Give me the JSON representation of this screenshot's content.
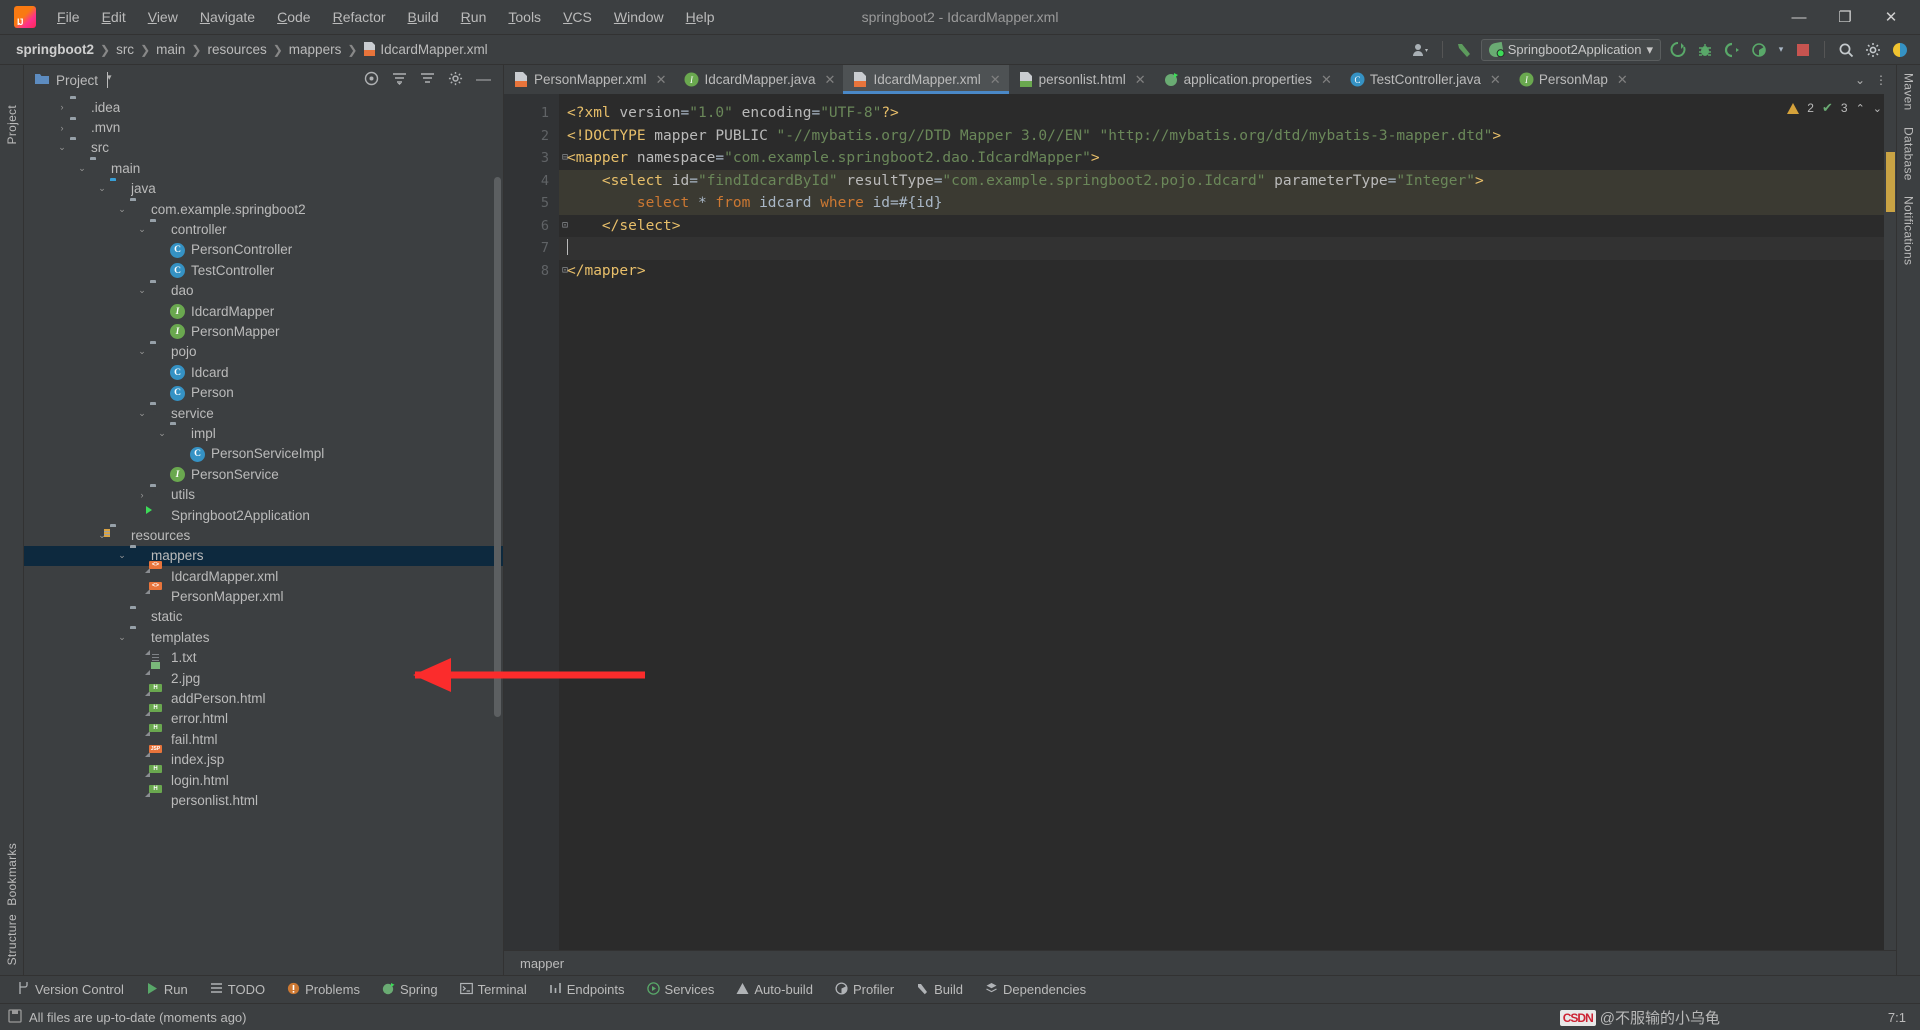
{
  "window": {
    "title": "springboot2 - IdcardMapper.xml",
    "minimize": "—",
    "maximize": "❐",
    "close": "✕"
  },
  "menu": [
    {
      "label": "File"
    },
    {
      "label": "Edit"
    },
    {
      "label": "View"
    },
    {
      "label": "Navigate"
    },
    {
      "label": "Code"
    },
    {
      "label": "Refactor"
    },
    {
      "label": "Build"
    },
    {
      "label": "Run"
    },
    {
      "label": "Tools"
    },
    {
      "label": "VCS"
    },
    {
      "label": "Window"
    },
    {
      "label": "Help"
    }
  ],
  "breadcrumb": {
    "segments": [
      "springboot2",
      "src",
      "main",
      "resources",
      "mappers",
      "IdcardMapper.xml"
    ],
    "separator": "❯"
  },
  "toolbar": {
    "run_config": "Springboot2Application",
    "dropdown_caret": "▾",
    "icons": [
      {
        "name": "account-icon",
        "glyph": "♟"
      },
      {
        "name": "build-hammer-icon",
        "glyph": "⚒"
      },
      {
        "name": "run-icon",
        "glyph": "➤"
      },
      {
        "name": "debug-icon",
        "glyph": "⚙"
      },
      {
        "name": "run-coverage-icon",
        "glyph": "◔"
      },
      {
        "name": "profiler-icon",
        "glyph": "◑"
      },
      {
        "name": "stop-icon",
        "glyph": "■"
      },
      {
        "name": "search-everywhere-icon",
        "glyph": "⌕"
      },
      {
        "name": "settings-gear-icon",
        "glyph": "⚙"
      },
      {
        "name": "ide-feature-icon",
        "glyph": "◕"
      }
    ]
  },
  "project_panel": {
    "title": "Project",
    "caret": "▾",
    "tool_icons": [
      {
        "name": "select-opened-file-icon",
        "glyph": "◎"
      },
      {
        "name": "expand-all-icon",
        "glyph": "≡"
      },
      {
        "name": "collapse-all-icon",
        "glyph": "≡"
      },
      {
        "name": "settings-gear-icon",
        "glyph": "⚙"
      },
      {
        "name": "hide-panel-icon",
        "glyph": "—"
      }
    ],
    "tree": [
      {
        "label": ".idea",
        "indent": 1,
        "arrow": "›",
        "icon": "folder",
        "selected": false
      },
      {
        "label": ".mvn",
        "indent": 1,
        "arrow": "›",
        "icon": "folder",
        "selected": false
      },
      {
        "label": "src",
        "indent": 1,
        "arrow": "⌄",
        "icon": "folder",
        "selected": false
      },
      {
        "label": "main",
        "indent": 2,
        "arrow": "⌄",
        "icon": "folder",
        "selected": false
      },
      {
        "label": "java",
        "indent": 3,
        "arrow": "⌄",
        "icon": "folder-blue",
        "selected": false
      },
      {
        "label": "com.example.springboot2",
        "indent": 4,
        "arrow": "⌄",
        "icon": "package",
        "selected": false
      },
      {
        "label": "controller",
        "indent": 5,
        "arrow": "⌄",
        "icon": "package",
        "selected": false
      },
      {
        "label": "PersonController",
        "indent": 6,
        "arrow": "",
        "icon": "class",
        "selected": false
      },
      {
        "label": "TestController",
        "indent": 6,
        "arrow": "",
        "icon": "class",
        "selected": false
      },
      {
        "label": "dao",
        "indent": 5,
        "arrow": "⌄",
        "icon": "package",
        "selected": false
      },
      {
        "label": "IdcardMapper",
        "indent": 6,
        "arrow": "",
        "icon": "interface",
        "selected": false
      },
      {
        "label": "PersonMapper",
        "indent": 6,
        "arrow": "",
        "icon": "interface",
        "selected": false
      },
      {
        "label": "pojo",
        "indent": 5,
        "arrow": "⌄",
        "icon": "package",
        "selected": false
      },
      {
        "label": "Idcard",
        "indent": 6,
        "arrow": "",
        "icon": "class",
        "selected": false
      },
      {
        "label": "Person",
        "indent": 6,
        "arrow": "",
        "icon": "class",
        "selected": false
      },
      {
        "label": "service",
        "indent": 5,
        "arrow": "⌄",
        "icon": "package",
        "selected": false
      },
      {
        "label": "impl",
        "indent": 6,
        "arrow": "⌄",
        "icon": "package",
        "selected": false
      },
      {
        "label": "PersonServiceImpl",
        "indent": 7,
        "arrow": "",
        "icon": "class",
        "selected": false
      },
      {
        "label": "PersonService",
        "indent": 6,
        "arrow": "",
        "icon": "interface",
        "selected": false
      },
      {
        "label": "utils",
        "indent": 5,
        "arrow": "›",
        "icon": "package",
        "selected": false
      },
      {
        "label": "Springboot2Application",
        "indent": 5,
        "arrow": "",
        "icon": "spring",
        "selected": false
      },
      {
        "label": "resources",
        "indent": 3,
        "arrow": "⌄",
        "icon": "folder-res",
        "selected": false
      },
      {
        "label": "mappers",
        "indent": 4,
        "arrow": "⌄",
        "icon": "folder",
        "selected": true
      },
      {
        "label": "IdcardMapper.xml",
        "indent": 5,
        "arrow": "",
        "icon": "file-xml",
        "selected": false
      },
      {
        "label": "PersonMapper.xml",
        "indent": 5,
        "arrow": "",
        "icon": "file-xml",
        "selected": false
      },
      {
        "label": "static",
        "indent": 4,
        "arrow": "",
        "icon": "folder",
        "selected": false
      },
      {
        "label": "templates",
        "indent": 4,
        "arrow": "⌄",
        "icon": "folder",
        "selected": false
      },
      {
        "label": "1.txt",
        "indent": 5,
        "arrow": "",
        "icon": "file-txt",
        "selected": false
      },
      {
        "label": "2.jpg",
        "indent": 5,
        "arrow": "",
        "icon": "file-img",
        "selected": false
      },
      {
        "label": "addPerson.html",
        "indent": 5,
        "arrow": "",
        "icon": "file-html",
        "selected": false
      },
      {
        "label": "error.html",
        "indent": 5,
        "arrow": "",
        "icon": "file-html",
        "selected": false
      },
      {
        "label": "fail.html",
        "indent": 5,
        "arrow": "",
        "icon": "file-html",
        "selected": false
      },
      {
        "label": "index.jsp",
        "indent": 5,
        "arrow": "",
        "icon": "file-jsp",
        "selected": false
      },
      {
        "label": "login.html",
        "indent": 5,
        "arrow": "",
        "icon": "file-html",
        "selected": false
      },
      {
        "label": "personlist.html",
        "indent": 5,
        "arrow": "",
        "icon": "file-html",
        "selected": false
      }
    ]
  },
  "left_strip": {
    "project": "Project",
    "bookmarks": "Bookmarks",
    "structure": "Structure"
  },
  "right_strip": {
    "maven": "Maven",
    "database": "Database",
    "notifications": "Notifications"
  },
  "editor": {
    "tabs": [
      {
        "label": "PersonMapper.xml",
        "icon": "xml",
        "active": false
      },
      {
        "label": "IdcardMapper.java",
        "icon": "iface",
        "active": false
      },
      {
        "label": "IdcardMapper.xml",
        "icon": "xml",
        "active": true
      },
      {
        "label": "personlist.html",
        "icon": "html",
        "active": false
      },
      {
        "label": "application.properties",
        "icon": "spring",
        "active": false
      },
      {
        "label": "TestController.java",
        "icon": "class",
        "active": false
      },
      {
        "label": "PersonMap",
        "icon": "iface",
        "active": false
      }
    ],
    "tab_close": "✕",
    "tabs_overflow": "⌄",
    "tabs_more": "⋮",
    "line_numbers": [
      "1",
      "2",
      "3",
      "4",
      "5",
      "6",
      "7",
      "8"
    ],
    "inspection": {
      "warnings": "2",
      "weak_warnings": "3",
      "caret_up": "⌃",
      "caret_down": "⌄"
    },
    "breadcrumb_bottom": "mapper",
    "code_lines": [
      {
        "n": 1,
        "tokens": [
          {
            "t": "<?xml",
            "c": "docc"
          },
          {
            "t": " version",
            "c": "attrc"
          },
          {
            "t": "=",
            "c": "plainc"
          },
          {
            "t": "\"1.0\"",
            "c": "strc"
          },
          {
            "t": " encoding",
            "c": "attrc"
          },
          {
            "t": "=",
            "c": "plainc"
          },
          {
            "t": "\"UTF-8\"",
            "c": "strc"
          },
          {
            "t": "?>",
            "c": "docc"
          }
        ]
      },
      {
        "n": 2,
        "tokens": [
          {
            "t": "<!DOCTYPE",
            "c": "docc"
          },
          {
            "t": " mapper PUBLIC ",
            "c": "attrc"
          },
          {
            "t": "\"-//mybatis.org//DTD Mapper 3.0//EN\"",
            "c": "strc"
          },
          {
            "t": " ",
            "c": "plainc"
          },
          {
            "t": "\"http://mybatis.org/dtd/mybatis-3-mapper.dtd\"",
            "c": "strc"
          },
          {
            "t": ">",
            "c": "docc"
          }
        ]
      },
      {
        "n": 3,
        "tokens": [
          {
            "t": "<mapper",
            "c": "tagc"
          },
          {
            "t": " namespace",
            "c": "attrc"
          },
          {
            "t": "=",
            "c": "plainc"
          },
          {
            "t": "\"com.example.springboot2.dao.IdcardMapper\"",
            "c": "strc"
          },
          {
            "t": ">",
            "c": "tagc"
          }
        ]
      },
      {
        "n": 4,
        "tokens": [
          {
            "t": "    <select",
            "c": "tagc"
          },
          {
            "t": " id",
            "c": "attrc"
          },
          {
            "t": "=",
            "c": "plainc"
          },
          {
            "t": "\"findIdcardById\"",
            "c": "strc"
          },
          {
            "t": " resultType",
            "c": "attrc"
          },
          {
            "t": "=",
            "c": "plainc"
          },
          {
            "t": "\"com.example.springboot2.pojo.Idcard\"",
            "c": "strc"
          },
          {
            "t": " parameterType",
            "c": "attrc"
          },
          {
            "t": "=",
            "c": "plainc"
          },
          {
            "t": "\"Integer\"",
            "c": "strc"
          },
          {
            "t": ">",
            "c": "tagc"
          }
        ]
      },
      {
        "n": 5,
        "tokens": [
          {
            "t": "        select ",
            "c": "kwc"
          },
          {
            "t": "* ",
            "c": "plainc"
          },
          {
            "t": "from ",
            "c": "kwc"
          },
          {
            "t": "idcard ",
            "c": "plainc"
          },
          {
            "t": "where ",
            "c": "kwc"
          },
          {
            "t": "id",
            "c": "plainc"
          },
          {
            "t": "=#{id}",
            "c": "plainc"
          }
        ]
      },
      {
        "n": 6,
        "tokens": [
          {
            "t": "    </select>",
            "c": "tagc"
          }
        ]
      },
      {
        "n": 7,
        "tokens": [
          {
            "t": "",
            "c": "plainc"
          }
        ]
      },
      {
        "n": 8,
        "tokens": [
          {
            "t": "</mapper>",
            "c": "tagc"
          }
        ]
      }
    ]
  },
  "tool_window_bar": [
    {
      "label": "Version Control",
      "icon": "branch-icon"
    },
    {
      "label": "Run",
      "icon": "run-icon"
    },
    {
      "label": "TODO",
      "icon": "todo-icon"
    },
    {
      "label": "Problems",
      "icon": "problems-icon"
    },
    {
      "label": "Spring",
      "icon": "spring-icon"
    },
    {
      "label": "Terminal",
      "icon": "terminal-icon"
    },
    {
      "label": "Endpoints",
      "icon": "endpoints-icon"
    },
    {
      "label": "Services",
      "icon": "services-icon"
    },
    {
      "label": "Auto-build",
      "icon": "autobuild-icon"
    },
    {
      "label": "Profiler",
      "icon": "profiler-icon"
    },
    {
      "label": "Build",
      "icon": "build-icon"
    },
    {
      "label": "Dependencies",
      "icon": "dependencies-icon"
    }
  ],
  "status_bar": {
    "message": "All files are up-to-date (moments ago)",
    "caret_position": "7:1",
    "watermark": "@不服输的小乌龟",
    "watermark_badge": "CSDN"
  }
}
